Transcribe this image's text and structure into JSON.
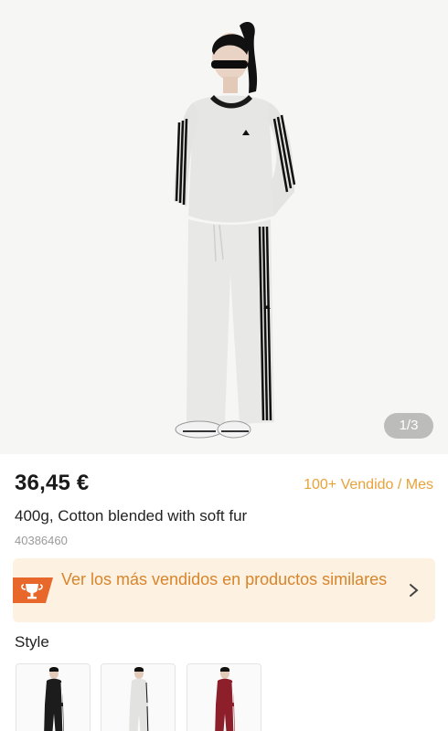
{
  "product": {
    "image_counter": "1/3",
    "price": "36,45 €",
    "sold": "100+ Vendido / Mes",
    "title": "400g, Cotton blended with soft fur",
    "sku": "40386460"
  },
  "banner": {
    "text": "Ver los más vendidos en productos similares",
    "accent_color": "#e8672a"
  },
  "style": {
    "label": "Style",
    "options": [
      {
        "color_name": "black",
        "color": "#1c1c1c"
      },
      {
        "color_name": "light-grey",
        "color": "#e6e6e4"
      },
      {
        "color_name": "burgundy",
        "color": "#8c1f2a"
      }
    ]
  }
}
